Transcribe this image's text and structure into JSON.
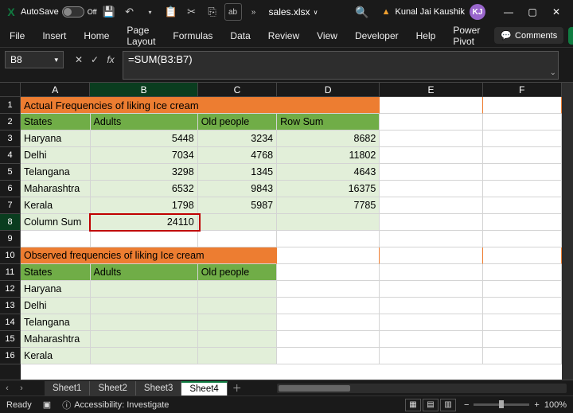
{
  "titlebar": {
    "autosave_label": "AutoSave",
    "autosave_state": "Off",
    "filename": "sales.xlsx",
    "user_name": "Kunal Jai Kaushik",
    "user_initials": "KJ"
  },
  "ribbon": {
    "tabs": [
      "File",
      "Insert",
      "Home",
      "Page Layout",
      "Formulas",
      "Data",
      "Review",
      "View",
      "Developer",
      "Help",
      "Power Pivot"
    ],
    "comments_label": "Comments"
  },
  "formula_bar": {
    "cell_ref": "B8",
    "formula": "=SUM(B3:B7)"
  },
  "columns": [
    "A",
    "B",
    "C",
    "D",
    "E",
    "F"
  ],
  "row_numbers": [
    "1",
    "2",
    "3",
    "4",
    "5",
    "6",
    "7",
    "8",
    "9",
    "10",
    "11",
    "12",
    "13",
    "14",
    "15",
    "16"
  ],
  "table1": {
    "title": "Actual Frequencies of liking Ice cream",
    "headers": [
      "States",
      "Adults",
      "Old people",
      "Row Sum"
    ],
    "rows": [
      [
        "Haryana",
        "5448",
        "3234",
        "8682"
      ],
      [
        "Delhi",
        "7034",
        "4768",
        "11802"
      ],
      [
        "Telangana",
        "3298",
        "1345",
        "4643"
      ],
      [
        "Maharashtra",
        "6532",
        "9843",
        "16375"
      ],
      [
        "Kerala",
        "1798",
        "5987",
        "7785"
      ]
    ],
    "footer_label": "Column Sum",
    "footer_value": "24110"
  },
  "table2": {
    "title": "Observed frequencies of liking Ice cream",
    "headers": [
      "States",
      "Adults",
      "Old people"
    ],
    "rows": [
      "Haryana",
      "Delhi",
      "Telangana",
      "Maharashtra",
      "Kerala"
    ]
  },
  "sheet_tabs": [
    "Sheet1",
    "Sheet2",
    "Sheet3",
    "Sheet4"
  ],
  "active_sheet": "Sheet4",
  "statusbar": {
    "mode": "Ready",
    "accessibility": "Accessibility: Investigate",
    "zoom": "100%"
  }
}
